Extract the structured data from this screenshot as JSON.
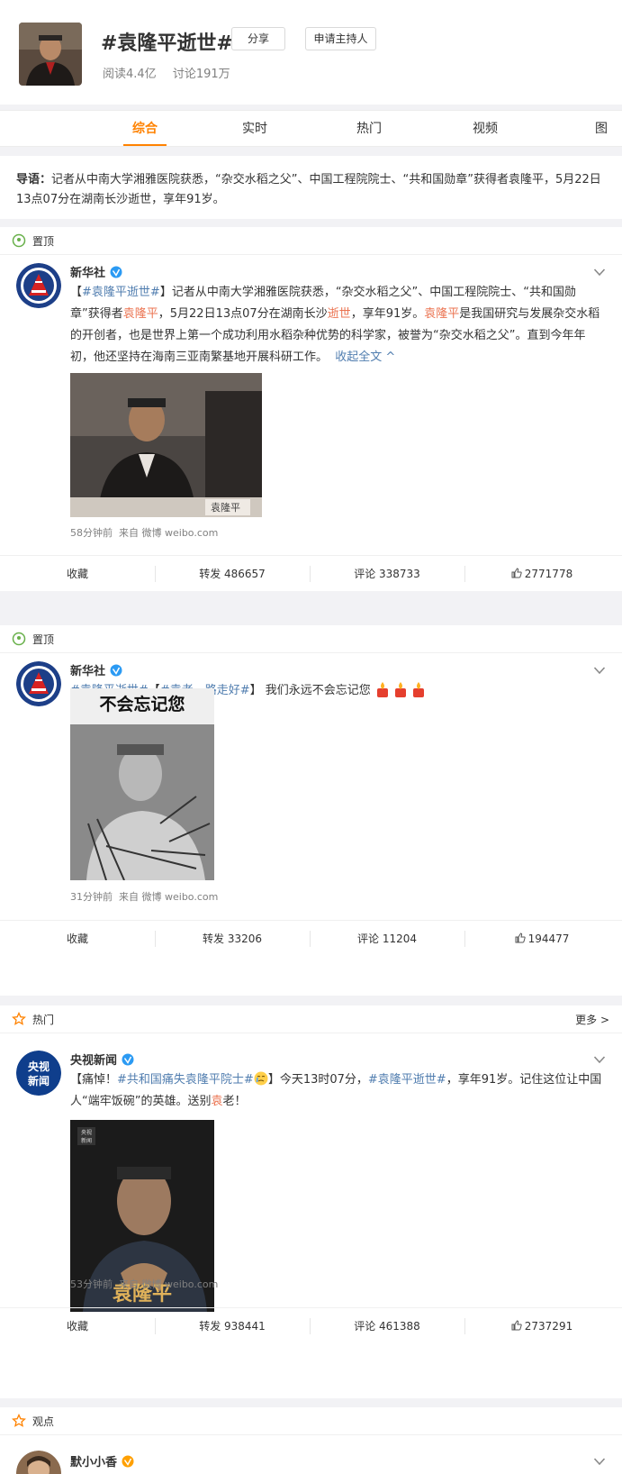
{
  "topic": {
    "title": "#袁隆平逝世#",
    "share_label": "分享",
    "apply_host_label": "申请主持人",
    "reads": "阅读4.4亿",
    "discussions": "讨论191万"
  },
  "tabs": [
    "综合",
    "实时",
    "热门",
    "视频",
    "图"
  ],
  "intro": {
    "label": "导语：",
    "text": "记者从中南大学湘雅医院获悉，“杂交水稻之父”、中国工程院院士、“共和国勋章”获得者袁隆平，5月22日13点07分在湖南长沙逝世，享年91岁。"
  },
  "posts": [
    {
      "section_label": "置顶",
      "section_icon": "pin-icon",
      "author": "新华社",
      "text_parts": [
        "【",
        "#袁隆平逝世#",
        "】记者从中南大学湘雅医院获悉，“杂交水稻之父”、中国工程院院士、“共和国勋章”获得者",
        "袁隆平",
        "，5月22日13点07分在湖南长沙",
        "逝世",
        "，享年91岁。",
        "袁隆平",
        "是我国研究与发展杂交水稻的开创者，也是世界上第一个成功利用水稻杂种优势的科学家，被誉为“杂交水稻之父”。直到今年年初，他还坚持在海南三亚南繁基地开展科研工作。",
        "收起全文"
      ],
      "image_caption": "袁隆平",
      "time": "58分钟前",
      "source": "来自 微博 weibo.com",
      "favorite_label": "收藏",
      "repost": "转发 486657",
      "comment": "评论 338733",
      "like": "2771778"
    },
    {
      "section_label": "置顶",
      "section_icon": "pin-icon",
      "author": "新华社",
      "text_parts": [
        "#袁隆平逝世#",
        "【",
        "#袁老一路走好#",
        "】 我们永远不会忘记您"
      ],
      "image_caption": "不会忘记您",
      "time": "31分钟前",
      "source": "来自 微博 weibo.com",
      "favorite_label": "收藏",
      "repost": "转发 33206",
      "comment": "评论 11204",
      "like": "194477"
    },
    {
      "section_label": "热门",
      "section_icon": "star-icon",
      "more_label": "更多",
      "author": "央视新闻",
      "avatar_text": [
        "央视",
        "新闻"
      ],
      "text_parts": [
        "【痛悼！",
        "#共和国痛失袁隆平院士#",
        "】今天13时07分，",
        "#袁隆平逝世#",
        "，享年91岁。记住这位让中国人“端牢饭碗”的英雄。送别",
        "袁",
        "老！"
      ],
      "image_logo": [
        "央视",
        "新闻"
      ],
      "image_caption": "袁隆平",
      "time": "53分钟前",
      "source": "来自 微博 weibo.com",
      "favorite_label": "收藏",
      "repost": "转发 938441",
      "comment": "评论 461388",
      "like": "2737291"
    },
    {
      "section_label": "观点",
      "section_icon": "star-icon",
      "author": "默小小香"
    }
  ],
  "colors": {
    "accent": "#ff8200",
    "link": "#507daf",
    "highlight": "#eb7350",
    "verified": "#ffa000"
  }
}
